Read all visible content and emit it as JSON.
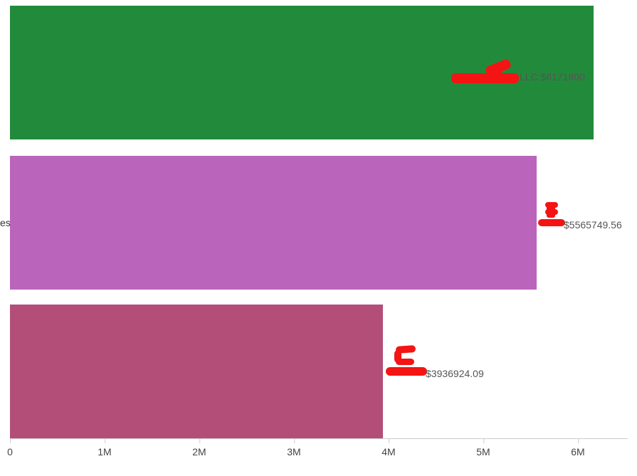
{
  "chart_data": {
    "type": "bar",
    "orientation": "horizontal",
    "xlabel": "",
    "ylabel": "",
    "xlim": [
      0,
      6500000
    ],
    "x_ticks": [
      {
        "value": 0,
        "label": "0"
      },
      {
        "value": 1000000,
        "label": "1M"
      },
      {
        "value": 2000000,
        "label": "2M"
      },
      {
        "value": 3000000,
        "label": "3M"
      },
      {
        "value": 4000000,
        "label": "4M"
      },
      {
        "value": 5000000,
        "label": "5M"
      },
      {
        "value": 6000000,
        "label": "6M"
      }
    ],
    "series": [
      {
        "name": "LLC",
        "value": 6171800,
        "color": "#228b3b",
        "label": "LLC:$6171800"
      },
      {
        "name": "es",
        "value": 5565749.56,
        "color": "#ba65bb",
        "label": "$5565749.56"
      },
      {
        "name": "",
        "value": 3936924.09,
        "color": "#b34e78",
        "label": "$3936924.09"
      }
    ],
    "y_axis_partial_label": "es",
    "annotations": [
      {
        "letter": "A",
        "series_index": 0,
        "redacted": true
      },
      {
        "letter": "B",
        "series_index": 1,
        "redacted": true
      },
      {
        "letter": "C",
        "series_index": 2,
        "redacted": true
      }
    ]
  }
}
